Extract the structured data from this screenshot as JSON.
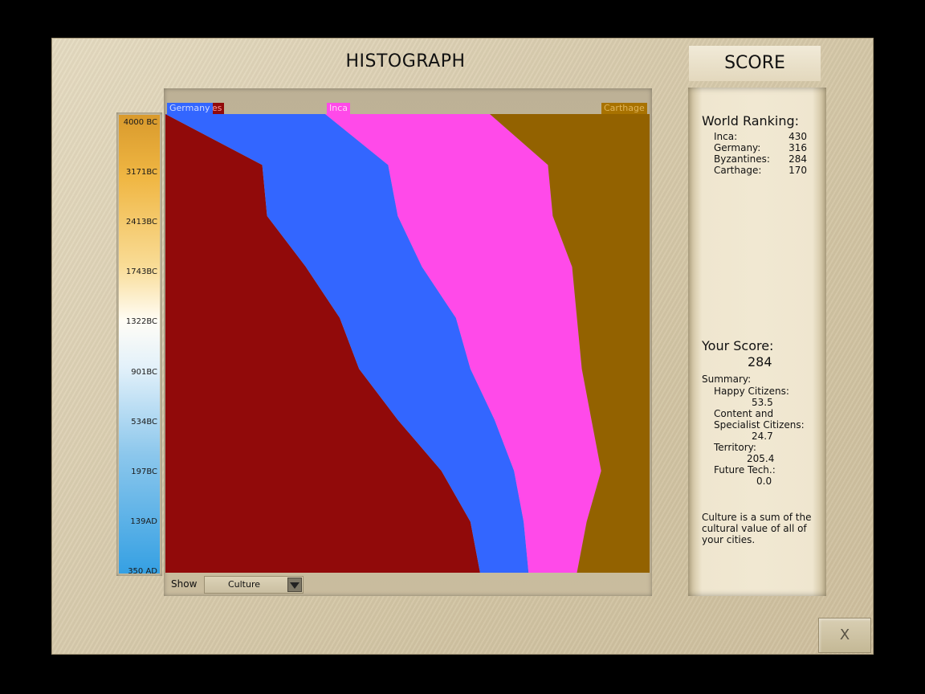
{
  "screen": {
    "title": "HISTOGRAPH",
    "score_tab": "SCORE",
    "close_label": "X"
  },
  "timeline": {
    "ticks": [
      "4000 BC",
      "3171BC",
      "2413BC",
      "1743BC",
      "1322BC",
      "901BC",
      "534BC",
      "197BC",
      "139AD",
      "350 AD"
    ]
  },
  "chart_data": {
    "type": "area",
    "stacked": "normalized-100%",
    "orientation": "vertical-time-axis",
    "title": "",
    "x": [
      "4000 BC",
      "3171BC",
      "2413BC",
      "1743BC",
      "1322BC",
      "901BC",
      "534BC",
      "197BC",
      "139AD",
      "350 AD"
    ],
    "series": [
      {
        "name": "Byzantines",
        "color": "#910a0a",
        "values": [
          0,
          20,
          21,
          29,
          36,
          40,
          48,
          57,
          63,
          65
        ]
      },
      {
        "name": "Germany",
        "color": "#3366ff",
        "values": [
          33,
          26,
          27,
          24,
          24,
          23,
          20,
          15,
          11,
          10
        ]
      },
      {
        "name": "Inca",
        "color": "#ff4ae9",
        "values": [
          34,
          33,
          32,
          31,
          25,
          23,
          20,
          18,
          13,
          10
        ]
      },
      {
        "name": "Carthage",
        "color": "#936200",
        "values": [
          33,
          21,
          20,
          16,
          15,
          14,
          12,
          10,
          13,
          15
        ]
      }
    ]
  },
  "show": {
    "label": "Show",
    "selected": "Culture"
  },
  "ranking": {
    "heading": "World Ranking:",
    "rows": [
      {
        "name": "Inca:",
        "value": "430"
      },
      {
        "name": "Germany:",
        "value": "316"
      },
      {
        "name": "Byzantines:",
        "value": "284"
      },
      {
        "name": "Carthage:",
        "value": "170"
      }
    ]
  },
  "your_score": {
    "heading": "Your Score:",
    "value": "284",
    "summary_label": "Summary:",
    "happy_label": "Happy Citizens:",
    "happy_value": "53.5",
    "content_label_1": "Content and",
    "content_label_2": "Specialist Citizens:",
    "content_value": "24.7",
    "territory_label": "Territory:",
    "territory_value": "205.4",
    "future_label": "Future Tech.:",
    "future_value": "0.0"
  },
  "note": {
    "line1": "Culture is a sum of the",
    "line2": "cultural value of all of",
    "line3": "your cities."
  }
}
